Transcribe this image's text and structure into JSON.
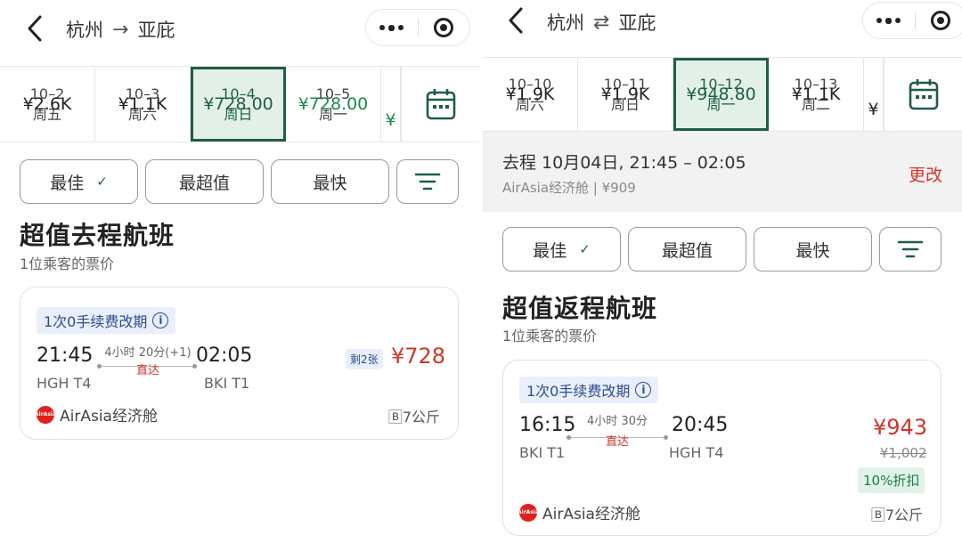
{
  "left": {
    "route": {
      "origin": "杭州",
      "destination": "亚庇",
      "arrow": "→"
    },
    "dates": [
      {
        "date": "10–2",
        "weekday": "周五",
        "price": "¥2.6K",
        "color": "#222222",
        "selected": false
      },
      {
        "date": "10–3",
        "weekday": "周六",
        "price": "¥1.1K",
        "color": "#222222",
        "selected": false
      },
      {
        "date": "10–4",
        "weekday": "周日",
        "price": "¥728.00",
        "color": "#1e5e45",
        "selected": true
      },
      {
        "date": "10–5",
        "weekday": "周一",
        "price": "¥728.00",
        "color": "#1c8a4e",
        "selected": false
      }
    ],
    "partial_price": "¥",
    "sort": {
      "best": "最佳",
      "best_check": "✓",
      "value": "最超值",
      "fastest": "最快"
    },
    "heading": "超值去程航班",
    "subheading": "1位乘客的票价",
    "flight": {
      "badge": "1次0手续费改期",
      "info": "i",
      "depart_time": "21:45",
      "depart_airport": "HGH T4",
      "duration": "4小时 20分(+1)",
      "stops": "直达",
      "arrive_time": "02:05",
      "arrive_airport": "BKI T1",
      "seats_left": "剩2张",
      "price": "¥728",
      "airline": "AirAsia经济舱",
      "baggage": "🄱7公斤"
    }
  },
  "right": {
    "route": {
      "origin": "杭州",
      "destination": "亚庇",
      "arrow": "⇄"
    },
    "dates": [
      {
        "date": "10–10",
        "weekday": "周六",
        "price": "¥1.9K",
        "color": "#222222",
        "selected": false
      },
      {
        "date": "10–11",
        "weekday": "周日",
        "price": "¥1.9K",
        "color": "#222222",
        "selected": false
      },
      {
        "date": "10–12",
        "weekday": "周一",
        "price": "¥948.80",
        "color": "#1e5e45",
        "selected": true
      },
      {
        "date": "10–13",
        "weekday": "周二",
        "price": "¥1.1K",
        "color": "#222222",
        "selected": false
      }
    ],
    "partial_price": "¥",
    "summary": {
      "line1": "去程 10月04日, 21:45 – 02:05",
      "line2": "AirAsia经济舱 | ¥909",
      "change": "更改"
    },
    "sort": {
      "best": "最佳",
      "best_check": "✓",
      "value": "最超值",
      "fastest": "最快"
    },
    "heading": "超值返程航班",
    "subheading": "1位乘客的票价",
    "flight": {
      "badge": "1次0手续费改期",
      "info": "i",
      "depart_time": "16:15",
      "depart_airport": "BKI T1",
      "duration": "4小时 30分",
      "stops": "直达",
      "arrive_time": "20:45",
      "arrive_airport": "HGH T4",
      "price": "¥943",
      "original_price": "¥1,002",
      "discount": "10%折扣",
      "airline": "AirAsia经济舱",
      "baggage": "🄱7公斤"
    }
  },
  "icons": {
    "back": "chevron-left-icon",
    "menu": "more-dots-icon",
    "record": "target-icon",
    "calendar": "calendar-icon",
    "filter": "filter-icon",
    "airline": "airasia-logo"
  },
  "colors": {
    "accent": "#1e5e45",
    "price_red": "#d0352b",
    "green": "#1c8a4e",
    "badge_blue": "#2e4d8a"
  }
}
